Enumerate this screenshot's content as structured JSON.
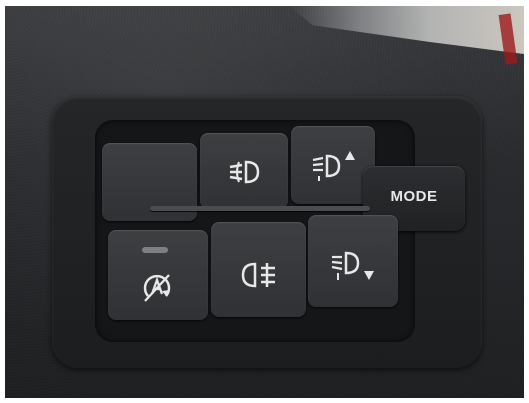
{
  "scene": {
    "description_label": "",
    "panel": {
      "mode_button": {
        "label": "MODE"
      },
      "buttons": [
        {
          "name": "blank-button",
          "icon": "none"
        },
        {
          "name": "front-fog-light-button",
          "icon": "front-fog-light-icon"
        },
        {
          "name": "headlight-level-up-button",
          "icon": "headlight-level-up-icon"
        },
        {
          "name": "auto-start-stop-button",
          "icon": "auto-start-stop-off-icon"
        },
        {
          "name": "rear-fog-light-button",
          "icon": "rear-fog-light-icon"
        },
        {
          "name": "headlight-level-down-button",
          "icon": "headlight-level-down-icon"
        }
      ]
    },
    "colors": {
      "panel": "#1b1d1f",
      "button": "#3a3c3f",
      "icon": "#e8e8e8",
      "indicator": "#7d7f80"
    }
  }
}
